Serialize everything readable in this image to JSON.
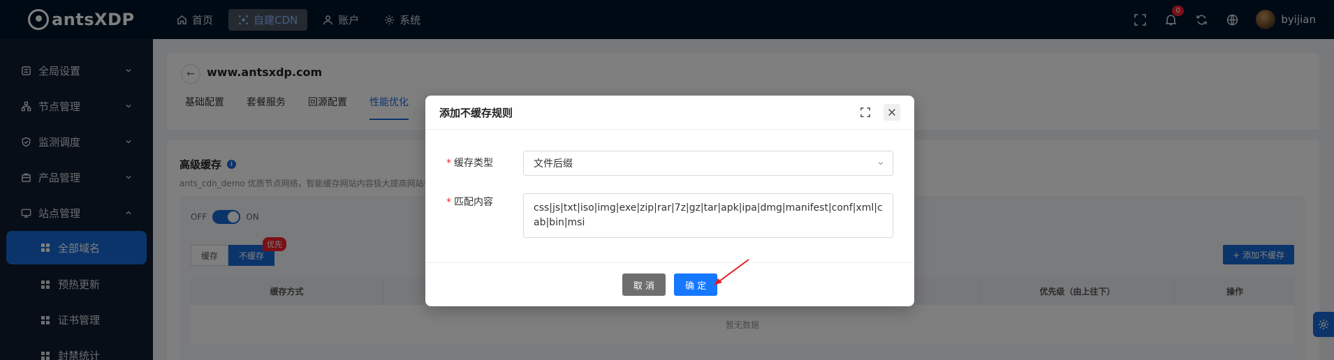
{
  "app": {
    "name": "antsXDP"
  },
  "topnav": [
    {
      "label": "首页",
      "icon": "home-icon",
      "active": false
    },
    {
      "label": "自建CDN",
      "icon": "cdn-icon",
      "active": true
    },
    {
      "label": "账户",
      "icon": "user-icon",
      "active": false
    },
    {
      "label": "系统",
      "icon": "gear-icon",
      "active": false
    }
  ],
  "header": {
    "notification_count": "0",
    "username": "byijian"
  },
  "sidebar": {
    "groups": [
      {
        "label": "全局设置",
        "icon": "settings-icon"
      },
      {
        "label": "节点管理",
        "icon": "node-icon"
      },
      {
        "label": "监测调度",
        "icon": "shield-icon"
      },
      {
        "label": "产品管理",
        "icon": "product-icon"
      },
      {
        "label": "站点管理",
        "icon": "site-icon"
      }
    ],
    "sub_items": [
      {
        "label": "全部域名",
        "active": true
      },
      {
        "label": "预热更新",
        "active": false
      },
      {
        "label": "证书管理",
        "active": false
      },
      {
        "label": "封禁统计",
        "active": false
      }
    ]
  },
  "page": {
    "site_title": "www.antsxdp.com",
    "tabs": [
      "基础配置",
      "套餐服务",
      "回源配置",
      "性能优化"
    ],
    "active_tab": "性能优化"
  },
  "card": {
    "title": "高级缓存",
    "description": "ants_cdn_demo 优质节点网络，智能缓存网站内容极大提高网站访问",
    "toggle_off": "OFF",
    "toggle_on": "ON",
    "seg_cache": "缓存",
    "seg_nocache": "不缓存",
    "priority_tag": "优先",
    "add_button": "+ 添加不缓存",
    "table_headers": [
      "缓存方式",
      "",
      "优先级（由上往下）",
      "操作"
    ],
    "empty_text": "暂无数据"
  },
  "modal": {
    "title": "添加不缓存规则",
    "fields": {
      "cache_type_label": "缓存类型",
      "cache_type_value": "文件后缀",
      "match_label": "匹配内容",
      "match_value": "css|js|txt|iso|img|exe|zip|rar|7z|gz|tar|apk|ipa|dmg|manifest|conf|xml|cab|bin|msi"
    },
    "cancel_label": "取 消",
    "ok_label": "确 定"
  },
  "colors": {
    "primary": "#1669d6",
    "topbar": "#001529",
    "sidebar": "#0f1d2e",
    "danger": "#f5222d",
    "annotation": "#e0202a"
  }
}
